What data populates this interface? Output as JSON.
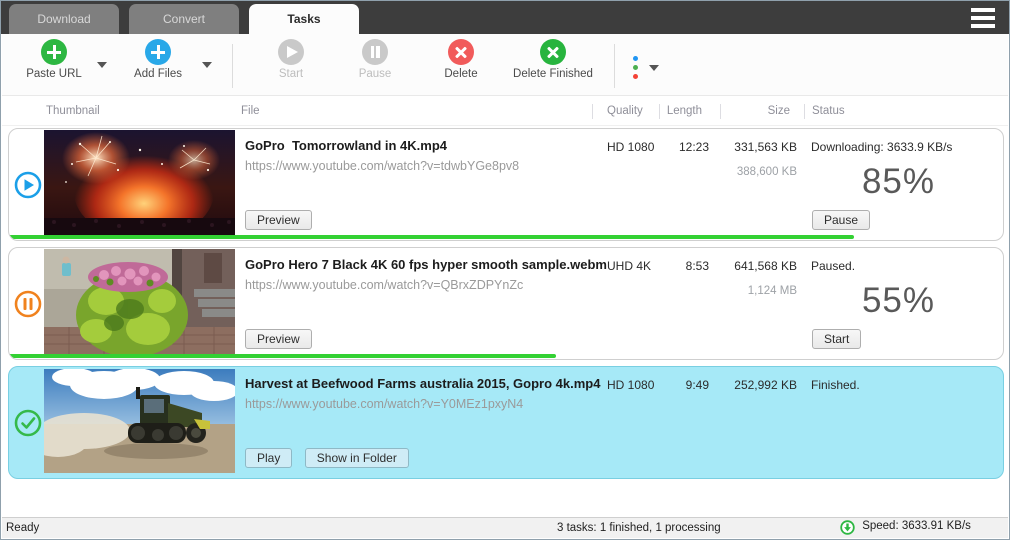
{
  "tabs": {
    "download": "Download",
    "convert": "Convert",
    "tasks": "Tasks",
    "active": "Tasks"
  },
  "toolbar": {
    "paste_url_label": "Paste URL",
    "add_files_label": "Add Files",
    "start_label": "Start",
    "pause_label": "Pause",
    "delete_label": "Delete",
    "delete_finished_label": "Delete Finished"
  },
  "table": {
    "columns": {
      "thumbnail": "Thumbnail",
      "file": "File",
      "quality": "Quality",
      "length": "Length",
      "size": "Size",
      "status": "Status"
    },
    "rows": [
      {
        "state": "downloading",
        "title": "GoPro  Tomorrowland in 4K.mp4",
        "url": "https://www.youtube.com/watch?v=tdwbYGe8pv8",
        "quality": "HD 1080",
        "length": "12:23",
        "size": "331,563 KB",
        "size_total": "388,600 KB",
        "status": "Downloading: 3633.9 KB/s",
        "percent_label": "85%",
        "progress": 85,
        "preview_label": "Preview",
        "action_label": "Pause"
      },
      {
        "state": "paused",
        "title": "GoPro Hero 7 Black 4K 60 fps hyper smooth sample.webm",
        "url": "https://www.youtube.com/watch?v=QBrxZDPYnZc",
        "quality": "UHD 4K",
        "length": "8:53",
        "size": "641,568 KB",
        "size_total": "1,124 MB",
        "status": "Paused.",
        "percent_label": "55%",
        "progress": 55,
        "preview_label": "Preview",
        "action_label": "Start"
      },
      {
        "state": "finished",
        "selected": true,
        "title": "Harvest at Beefwood Farms australia 2015, Gopro 4k.mp4",
        "url": "https://www.youtube.com/watch?v=Y0MEz1pxyN4",
        "quality": "HD 1080",
        "length": "9:49",
        "size": "252,992 KB",
        "status": "Finished.",
        "play_label": "Play",
        "show_in_folder_label": "Show in Folder"
      }
    ]
  },
  "status_bar": {
    "ready": "Ready",
    "tasks_summary": "3 tasks: 1 finished, 1 processing",
    "speed": "Speed: 3633.91 KB/s"
  },
  "colors": {
    "paste_url_green": "#2db742",
    "add_files_blue": "#29a8e8",
    "delete_red": "#f15b5b",
    "delete_finished_green": "#27b43e",
    "disabled_gray": "#c9c9c9",
    "progress_green": "#33d133",
    "selected_row_bg": "#a6e9f7",
    "row_play_blue": "#1b9fe8",
    "row_pause_orange": "#f0821e",
    "row_check_green": "#35b94a",
    "titlebar_dark": "#3d3d3d"
  }
}
